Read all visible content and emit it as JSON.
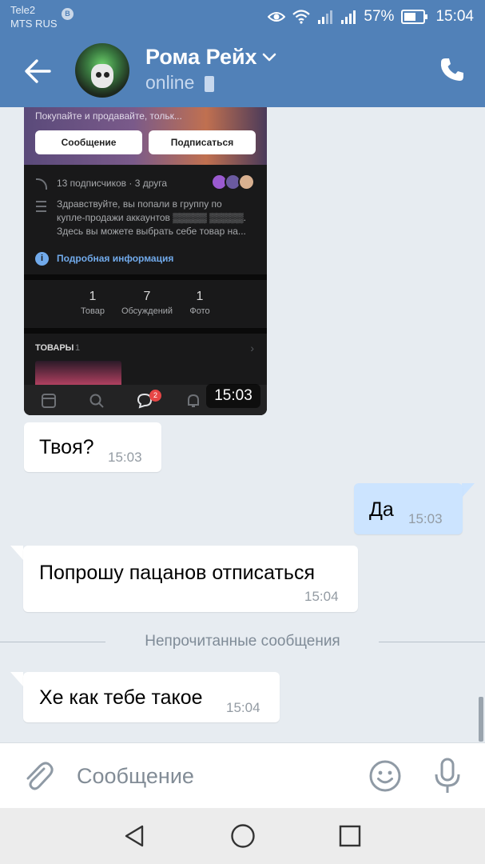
{
  "status_bar": {
    "carrier_line1": "Tele2",
    "carrier_line2": "MTS RUS",
    "carrier_badge": "B",
    "battery_percent": "57%",
    "time": "15:04"
  },
  "header": {
    "contact_name": "Рома Рейх",
    "contact_status": "online"
  },
  "shared_screenshot": {
    "cover_text": "Покупайте и продавайте, тольк...",
    "message_button": "Сообщение",
    "subscribe_button": "Подписаться",
    "subscribers_line": "13 подписчиков · 3 друга",
    "description_line1": "Здравствуйте, вы попали в группу по",
    "description_line2": "купле-продажи аккаунтов ▒▒▒▒▒ ▒▒▒▒▒.",
    "description_line3": "Здесь вы можете выбрать себе товар на...",
    "details_link": "Подробная информация",
    "stats": [
      {
        "count": "1",
        "label": "Товар"
      },
      {
        "count": "7",
        "label": "Обсуждений"
      },
      {
        "count": "1",
        "label": "Фото"
      }
    ],
    "goods_title": "ТОВАРЫ",
    "goods_count": "1",
    "messages_badge": "2",
    "time": "15:03"
  },
  "messages": [
    {
      "text": "Твоя?",
      "time": "15:03",
      "direction": "in"
    },
    {
      "text": "Да",
      "time": "15:03",
      "direction": "out"
    },
    {
      "text": "Попрошу пацанов отписаться",
      "time": "15:04",
      "direction": "in"
    },
    {
      "text": "Хе как тебе такое",
      "time": "15:04",
      "direction": "in"
    }
  ],
  "unread_divider": "Непрочитанные сообщения",
  "composer": {
    "placeholder": "Сообщение",
    "value": ""
  },
  "icons": {
    "back": "arrow-left-icon",
    "call": "phone-icon",
    "attach": "paperclip-icon",
    "emoji": "smiley-icon",
    "mic": "microphone-icon"
  },
  "colors": {
    "header": "#5181b8",
    "chat_background": "#e7ecf1",
    "incoming_bubble": "#ffffff",
    "outgoing_bubble": "#cce4ff",
    "link": "#71aaeb"
  }
}
